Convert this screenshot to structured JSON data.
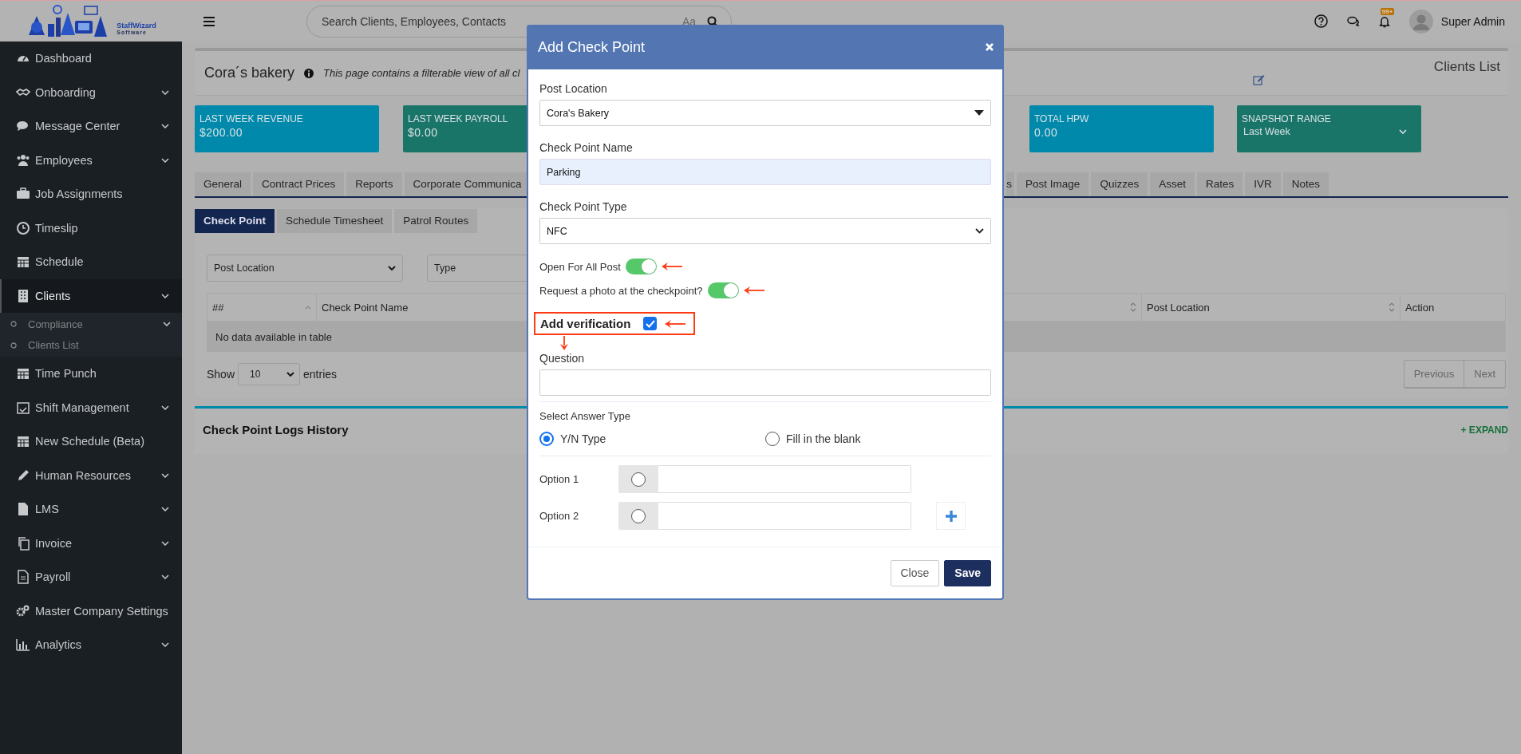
{
  "header": {
    "logo": {
      "name": "StaffWizard",
      "tagline": "Software"
    },
    "search": {
      "placeholder": "Search Clients, Employees, Contacts",
      "case_toggle": "Aa"
    },
    "notifications_badge": "99+",
    "user": "Super Admin"
  },
  "sidebar": {
    "items": [
      {
        "label": "Dashboard",
        "has_submenu": false,
        "selected": false
      },
      {
        "label": "Onboarding",
        "has_submenu": true,
        "selected": false,
        "expanded": false
      },
      {
        "label": "Message Center",
        "has_submenu": true,
        "selected": false,
        "expanded": false
      },
      {
        "label": "Employees",
        "has_submenu": true,
        "selected": false,
        "expanded": false
      },
      {
        "label": "Job Assignments",
        "has_submenu": false,
        "selected": false
      },
      {
        "label": "Timeslip",
        "has_submenu": false,
        "selected": false
      },
      {
        "label": "Schedule",
        "has_submenu": false,
        "selected": false
      },
      {
        "label": "Clients",
        "has_submenu": true,
        "selected": true,
        "expanded": true,
        "children": [
          {
            "label": "Compliance",
            "has_submenu": true
          },
          {
            "label": "Clients List",
            "has_submenu": false
          }
        ]
      },
      {
        "label": "Time Punch",
        "has_submenu": false,
        "selected": false
      },
      {
        "label": "Shift Management",
        "has_submenu": true,
        "selected": false,
        "expanded": false
      },
      {
        "label": "New Schedule (Beta)",
        "has_submenu": false,
        "selected": false
      },
      {
        "label": "Human Resources",
        "has_submenu": true,
        "selected": false,
        "expanded": false
      },
      {
        "label": "LMS",
        "has_submenu": true,
        "selected": false,
        "expanded": false
      },
      {
        "label": "Invoice",
        "has_submenu": true,
        "selected": false,
        "expanded": false
      },
      {
        "label": "Payroll",
        "has_submenu": true,
        "selected": false,
        "expanded": false
      },
      {
        "label": "Master Company Settings",
        "has_submenu": false,
        "selected": false
      },
      {
        "label": "Analytics",
        "has_submenu": true,
        "selected": false,
        "expanded": false
      }
    ]
  },
  "page": {
    "title": "Cora´s bakery",
    "info": "This page contains a filterable view of all cl",
    "breadcrumb": "Clients List"
  },
  "stats_left": [
    {
      "label": "LAST WEEK REVENUE",
      "value": "$200.00",
      "color": "#0089ab"
    },
    {
      "label": "LAST WEEK PAYROLL",
      "value": "$0.00",
      "color": "#1a7569"
    }
  ],
  "stats_right": [
    {
      "label": "TOTAL HPW",
      "value": "0.00",
      "color": "#0089ab"
    },
    {
      "label": "SNAPSHOT RANGE",
      "value": "Last Week",
      "color": "#1a7569",
      "kind": "dropdown"
    }
  ],
  "tabs_left": [
    {
      "label": "General",
      "selected": false
    },
    {
      "label": "Contract Prices",
      "selected": false
    },
    {
      "label": "Reports",
      "selected": false
    },
    {
      "label": "Corporate Communica",
      "selected": false
    }
  ],
  "tabs_right": [
    {
      "label": "s",
      "selected": false
    },
    {
      "label": "Post Image",
      "selected": false
    },
    {
      "label": "Quizzes",
      "selected": false
    },
    {
      "label": "Asset",
      "selected": false
    },
    {
      "label": "Rates",
      "selected": false
    },
    {
      "label": "IVR",
      "selected": false
    },
    {
      "label": "Notes",
      "selected": false
    }
  ],
  "subtabs": [
    {
      "label": "Check Point",
      "selected": true
    },
    {
      "label": "Schedule Timesheet",
      "selected": false
    },
    {
      "label": "Patrol Routes",
      "selected": false
    }
  ],
  "filters": [
    {
      "value": "Post Location"
    },
    {
      "value": "Type"
    }
  ],
  "table": {
    "columns_left": [
      "##",
      "Check Point Name"
    ],
    "columns_right": [
      "Post Location",
      "Action"
    ],
    "empty_message": "No data available in table"
  },
  "length": {
    "before": "Show",
    "value": "10",
    "after": "entries"
  },
  "pagination": [
    "Previous",
    "Next"
  ],
  "logs": {
    "title": "Check Point Logs History",
    "action": "+ EXPAND"
  },
  "modal": {
    "title": "Add Check Point",
    "post_location": {
      "label": "Post Location",
      "value": "Cora's Bakery"
    },
    "name": {
      "label": "Check Point Name",
      "value": "Parking"
    },
    "type": {
      "label": "Check Point Type",
      "value": "NFC"
    },
    "toggles": [
      {
        "label": "Open For All Post",
        "on": true
      },
      {
        "label": "Request a photo at the checkpoint?",
        "on": true
      }
    ],
    "verification": {
      "label": "Add verification",
      "checked": true
    },
    "question": {
      "label": "Question"
    },
    "answer_type": {
      "label": "Select Answer Type",
      "options": [
        {
          "label": "Y/N Type",
          "selected": true
        },
        {
          "label": "Fill in the blank",
          "selected": false
        }
      ]
    },
    "options": [
      {
        "label": "Option 1",
        "selected": false
      },
      {
        "label": "Option 2",
        "selected": false
      }
    ],
    "buttons": [
      {
        "label": "Close",
        "kind": "secondary"
      },
      {
        "label": "Save",
        "kind": "primary"
      }
    ]
  }
}
